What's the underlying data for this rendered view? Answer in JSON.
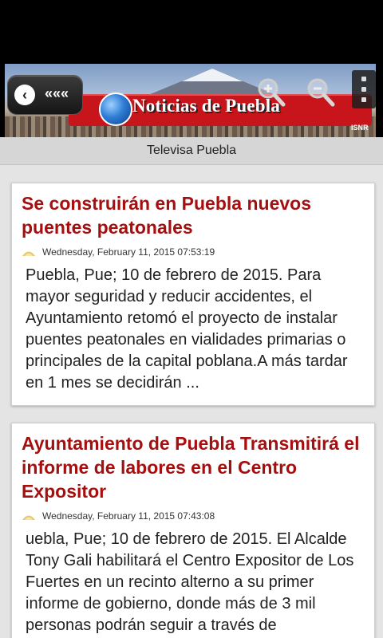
{
  "header": {
    "back_label": "«««",
    "logo_text": "Noticias de Puebla",
    "banner_tag": "ISNR",
    "icons": {
      "back": "back-arrow-icon",
      "zoom_in": "zoom-in-icon",
      "zoom_out": "zoom-out-icon",
      "menu": "overflow-menu-icon"
    }
  },
  "section": {
    "title": "Televisa Puebla"
  },
  "articles": [
    {
      "title": "Se construirán en Puebla nuevos puentes peatonales",
      "date": "Wednesday, February 11, 2015 07:53:19",
      "excerpt": "Puebla, Pue; 10 de febrero de 2015. Para mayor seguridad y reducir accidentes, el Ayuntamiento retomó el proyecto de instalar puentes peatonales en vialidades primarias o principales de la capital poblana.A más tardar en 1 mes se decidirán ..."
    },
    {
      "title": "Ayuntamiento de Puebla Transmitirá el informe de labores en el Centro Expositor",
      "date": "Wednesday, February 11, 2015 07:43:08",
      "excerpt": "uebla, Pue; 10 de febrero de 2015. El Alcalde Tony Gali habilitará el Centro Expositor de Los Fuertes en un recinto alterno a su primer informe de gobierno, donde más de 3 mil personas podrán seguir a través de"
    }
  ],
  "colors": {
    "title_red": "#a50f0f",
    "ribbon_red": "#c8141b",
    "background": "#e4e4e4"
  }
}
